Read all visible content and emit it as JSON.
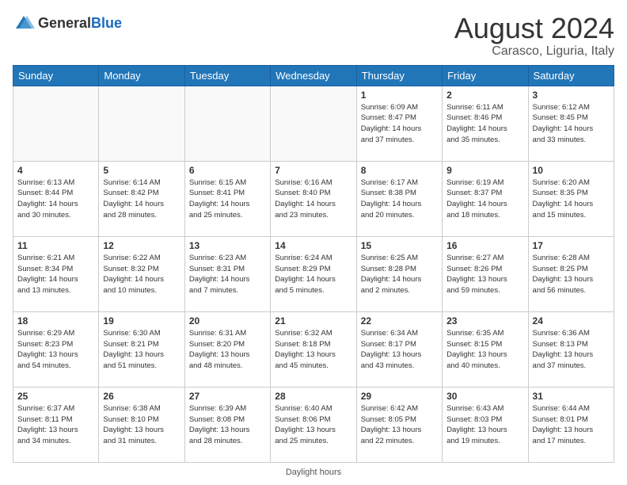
{
  "header": {
    "logo_general": "General",
    "logo_blue": "Blue",
    "title": "August 2024",
    "subtitle": "Carasco, Liguria, Italy"
  },
  "footer": {
    "daylight_label": "Daylight hours"
  },
  "days_of_week": [
    "Sunday",
    "Monday",
    "Tuesday",
    "Wednesday",
    "Thursday",
    "Friday",
    "Saturday"
  ],
  "weeks": [
    [
      {
        "day": "",
        "info": ""
      },
      {
        "day": "",
        "info": ""
      },
      {
        "day": "",
        "info": ""
      },
      {
        "day": "",
        "info": ""
      },
      {
        "day": "1",
        "info": "Sunrise: 6:09 AM\nSunset: 8:47 PM\nDaylight: 14 hours\nand 37 minutes."
      },
      {
        "day": "2",
        "info": "Sunrise: 6:11 AM\nSunset: 8:46 PM\nDaylight: 14 hours\nand 35 minutes."
      },
      {
        "day": "3",
        "info": "Sunrise: 6:12 AM\nSunset: 8:45 PM\nDaylight: 14 hours\nand 33 minutes."
      }
    ],
    [
      {
        "day": "4",
        "info": "Sunrise: 6:13 AM\nSunset: 8:44 PM\nDaylight: 14 hours\nand 30 minutes."
      },
      {
        "day": "5",
        "info": "Sunrise: 6:14 AM\nSunset: 8:42 PM\nDaylight: 14 hours\nand 28 minutes."
      },
      {
        "day": "6",
        "info": "Sunrise: 6:15 AM\nSunset: 8:41 PM\nDaylight: 14 hours\nand 25 minutes."
      },
      {
        "day": "7",
        "info": "Sunrise: 6:16 AM\nSunset: 8:40 PM\nDaylight: 14 hours\nand 23 minutes."
      },
      {
        "day": "8",
        "info": "Sunrise: 6:17 AM\nSunset: 8:38 PM\nDaylight: 14 hours\nand 20 minutes."
      },
      {
        "day": "9",
        "info": "Sunrise: 6:19 AM\nSunset: 8:37 PM\nDaylight: 14 hours\nand 18 minutes."
      },
      {
        "day": "10",
        "info": "Sunrise: 6:20 AM\nSunset: 8:35 PM\nDaylight: 14 hours\nand 15 minutes."
      }
    ],
    [
      {
        "day": "11",
        "info": "Sunrise: 6:21 AM\nSunset: 8:34 PM\nDaylight: 14 hours\nand 13 minutes."
      },
      {
        "day": "12",
        "info": "Sunrise: 6:22 AM\nSunset: 8:32 PM\nDaylight: 14 hours\nand 10 minutes."
      },
      {
        "day": "13",
        "info": "Sunrise: 6:23 AM\nSunset: 8:31 PM\nDaylight: 14 hours\nand 7 minutes."
      },
      {
        "day": "14",
        "info": "Sunrise: 6:24 AM\nSunset: 8:29 PM\nDaylight: 14 hours\nand 5 minutes."
      },
      {
        "day": "15",
        "info": "Sunrise: 6:25 AM\nSunset: 8:28 PM\nDaylight: 14 hours\nand 2 minutes."
      },
      {
        "day": "16",
        "info": "Sunrise: 6:27 AM\nSunset: 8:26 PM\nDaylight: 13 hours\nand 59 minutes."
      },
      {
        "day": "17",
        "info": "Sunrise: 6:28 AM\nSunset: 8:25 PM\nDaylight: 13 hours\nand 56 minutes."
      }
    ],
    [
      {
        "day": "18",
        "info": "Sunrise: 6:29 AM\nSunset: 8:23 PM\nDaylight: 13 hours\nand 54 minutes."
      },
      {
        "day": "19",
        "info": "Sunrise: 6:30 AM\nSunset: 8:21 PM\nDaylight: 13 hours\nand 51 minutes."
      },
      {
        "day": "20",
        "info": "Sunrise: 6:31 AM\nSunset: 8:20 PM\nDaylight: 13 hours\nand 48 minutes."
      },
      {
        "day": "21",
        "info": "Sunrise: 6:32 AM\nSunset: 8:18 PM\nDaylight: 13 hours\nand 45 minutes."
      },
      {
        "day": "22",
        "info": "Sunrise: 6:34 AM\nSunset: 8:17 PM\nDaylight: 13 hours\nand 43 minutes."
      },
      {
        "day": "23",
        "info": "Sunrise: 6:35 AM\nSunset: 8:15 PM\nDaylight: 13 hours\nand 40 minutes."
      },
      {
        "day": "24",
        "info": "Sunrise: 6:36 AM\nSunset: 8:13 PM\nDaylight: 13 hours\nand 37 minutes."
      }
    ],
    [
      {
        "day": "25",
        "info": "Sunrise: 6:37 AM\nSunset: 8:11 PM\nDaylight: 13 hours\nand 34 minutes."
      },
      {
        "day": "26",
        "info": "Sunrise: 6:38 AM\nSunset: 8:10 PM\nDaylight: 13 hours\nand 31 minutes."
      },
      {
        "day": "27",
        "info": "Sunrise: 6:39 AM\nSunset: 8:08 PM\nDaylight: 13 hours\nand 28 minutes."
      },
      {
        "day": "28",
        "info": "Sunrise: 6:40 AM\nSunset: 8:06 PM\nDaylight: 13 hours\nand 25 minutes."
      },
      {
        "day": "29",
        "info": "Sunrise: 6:42 AM\nSunset: 8:05 PM\nDaylight: 13 hours\nand 22 minutes."
      },
      {
        "day": "30",
        "info": "Sunrise: 6:43 AM\nSunset: 8:03 PM\nDaylight: 13 hours\nand 19 minutes."
      },
      {
        "day": "31",
        "info": "Sunrise: 6:44 AM\nSunset: 8:01 PM\nDaylight: 13 hours\nand 17 minutes."
      }
    ]
  ]
}
